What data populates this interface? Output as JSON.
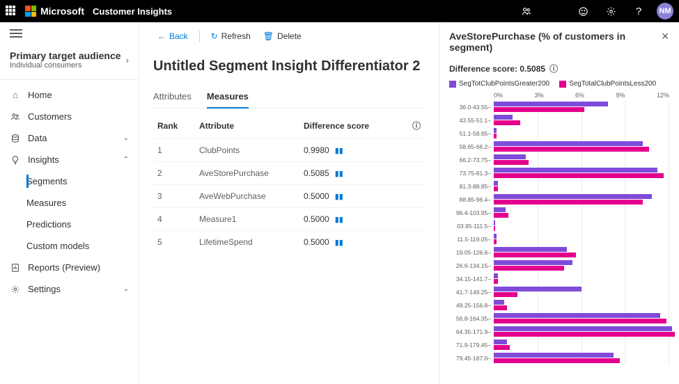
{
  "topbar": {
    "brand": "Microsoft",
    "app": "Customer Insights",
    "avatar": "NM"
  },
  "sidebar": {
    "audience_title": "Primary target audience",
    "audience_sub": "Individual consumers",
    "items": [
      {
        "label": "Home"
      },
      {
        "label": "Customers"
      },
      {
        "label": "Data"
      },
      {
        "label": "Insights"
      },
      {
        "label": "Reports (Preview)"
      },
      {
        "label": "Settings"
      }
    ],
    "insights_sub": [
      {
        "label": "Segments"
      },
      {
        "label": "Measures"
      },
      {
        "label": "Predictions"
      },
      {
        "label": "Custom models"
      }
    ]
  },
  "commands": {
    "back": "Back",
    "refresh": "Refresh",
    "delete": "Delete"
  },
  "page_title": "Untitled Segment Insight Differentiator 2",
  "tabs": {
    "attributes": "Attributes",
    "measures": "Measures"
  },
  "table": {
    "cols": {
      "rank": "Rank",
      "attribute": "Attribute",
      "score": "Difference score"
    },
    "rows": [
      {
        "rank": "1",
        "attr": "ClubPoints",
        "score": "0.9980"
      },
      {
        "rank": "2",
        "attr": "AveStorePurchase",
        "score": "0.5085"
      },
      {
        "rank": "3",
        "attr": "AveWebPurchase",
        "score": "0.5000"
      },
      {
        "rank": "4",
        "attr": "Measure1",
        "score": "0.5000"
      },
      {
        "rank": "5",
        "attr": "LifetimeSpend",
        "score": "0.5000"
      }
    ]
  },
  "panel": {
    "title": "AveStorePurchase (% of customers in segment)",
    "sub": "Difference score: 0.5085",
    "legend": {
      "a": "SegTotClubPointsGreater200",
      "b": "SegTotalClubPointsLess200"
    },
    "colors": {
      "a": "#7f4bd8",
      "b": "#e3008c"
    }
  },
  "chart_data": {
    "type": "bar",
    "orientation": "horizontal",
    "xlabel": "",
    "ylabel": "",
    "xlim": [
      0,
      12
    ],
    "ticks": [
      "0%",
      "3%",
      "6%",
      "9%",
      "12%"
    ],
    "categories": [
      "36.0-43.55",
      "43.55-51.1",
      "51.1-58.65",
      "58.65-66.2",
      "66.2-73.75",
      "73.75-81.3",
      "81.3-88.85",
      "88.85-96.4",
      "96.4-103.95",
      "03.95-111.5",
      "11.5-119.05",
      "19.05-126.6",
      "26.6-134.15",
      "34.15-141.7",
      "41.7-149.25",
      "49.25-156.8",
      "56.8-164.35",
      "64.35-171.9",
      "71.9-179.45",
      "79.45-187.0"
    ],
    "series": [
      {
        "name": "SegTotClubPointsGreater200",
        "values": [
          7.8,
          1.3,
          0.2,
          10.2,
          2.2,
          11.2,
          0.3,
          10.8,
          0.8,
          0.1,
          0.2,
          5.0,
          5.4,
          0.3,
          6.0,
          0.7,
          11.4,
          12.2,
          0.9,
          8.2
        ]
      },
      {
        "name": "SegTotalClubPointsLess200",
        "values": [
          6.2,
          1.8,
          0.2,
          10.6,
          2.4,
          11.6,
          0.3,
          10.2,
          1.0,
          0.1,
          0.2,
          5.6,
          4.8,
          0.3,
          1.6,
          0.9,
          11.8,
          12.4,
          1.1,
          8.6
        ]
      }
    ]
  }
}
